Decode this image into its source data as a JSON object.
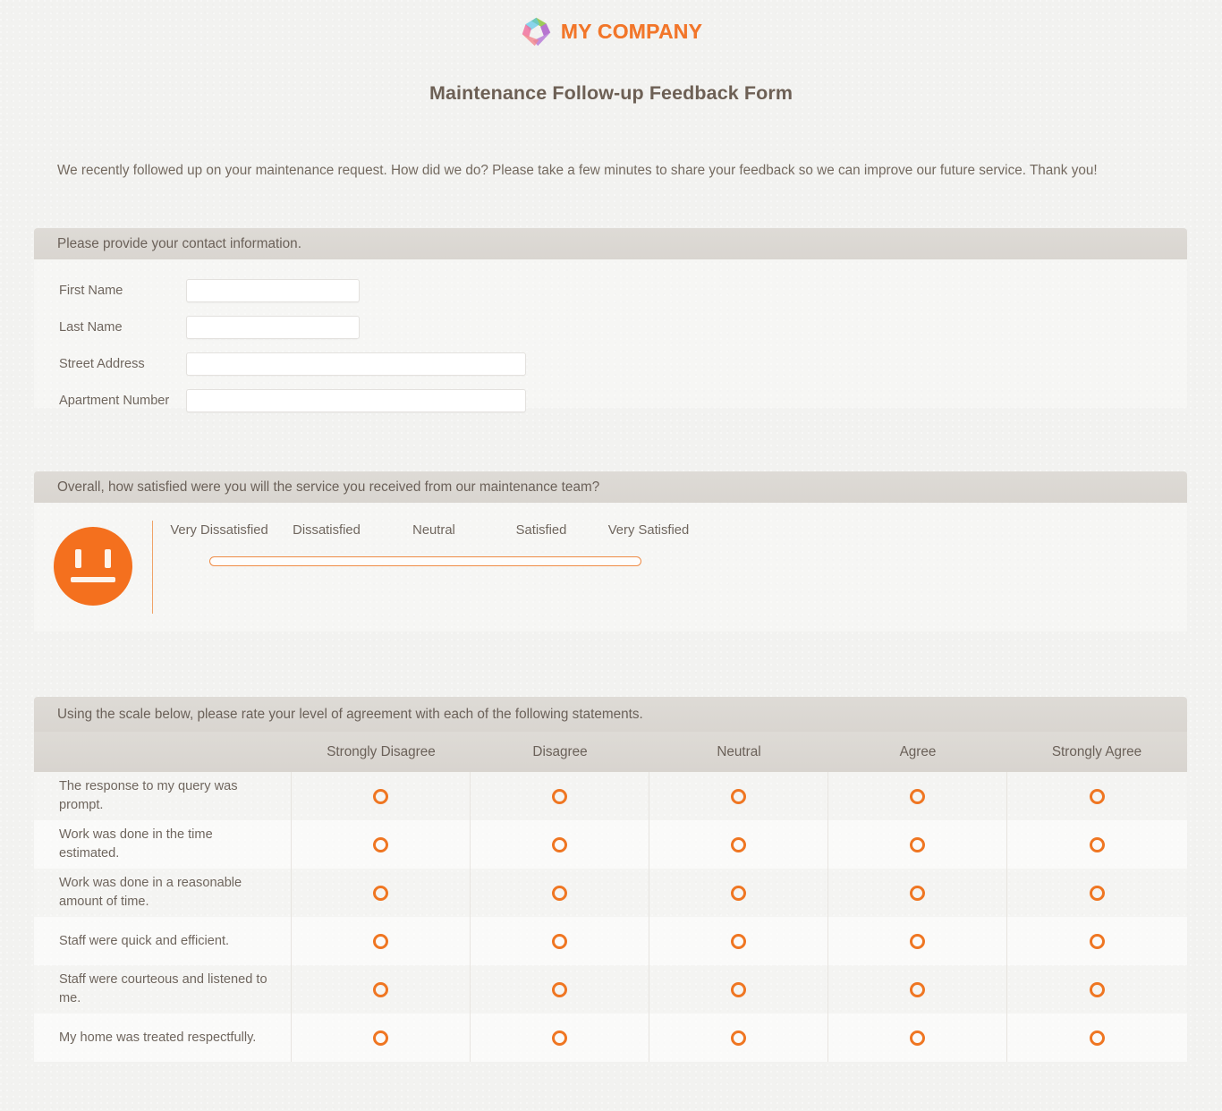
{
  "brand": {
    "logo_icon": "pinwheel-diamond-logo-icon",
    "name": "MY COMPANY",
    "logo_colors": [
      "#f06a9a",
      "#8dc63f",
      "#a855c8",
      "#4fa8e0"
    ],
    "text_color": "#f2762a"
  },
  "page": {
    "title": "Maintenance Follow-up Feedback Form",
    "intro": "We recently followed up on your maintenance request. How did we do? Please take a few minutes to share your feedback so we can improve our future service. Thank you!",
    "background_color": "#f2f2f0",
    "accent_color": "#ef7622",
    "header_bar_color": "#dedbd6",
    "text_color": "#6f665e"
  },
  "contact_section": {
    "heading": "Please provide your contact information.",
    "fields": [
      {
        "label": "First Name",
        "value": "",
        "placeholder": "",
        "size": "short"
      },
      {
        "label": "Last Name",
        "value": "",
        "placeholder": "",
        "size": "short"
      },
      {
        "label": "Street Address",
        "value": "",
        "placeholder": "",
        "size": "long"
      },
      {
        "label": "Apartment Number",
        "value": "",
        "placeholder": "",
        "size": "long"
      }
    ]
  },
  "satisfaction_section": {
    "heading": "Overall, how satisfied were you will the service you received from our maintenance team?",
    "face_icon": "neutral-face-icon",
    "scale_labels": [
      "Very Dissatisfied",
      "Dissatisfied",
      "Neutral",
      "Satisfied",
      "Very Satisfied"
    ],
    "slider_value": ""
  },
  "matrix_section": {
    "heading": "Using the scale below, please rate your level of agreement with each of the following statements.",
    "columns": [
      "Strongly Disagree",
      "Disagree",
      "Neutral",
      "Agree",
      "Strongly Agree"
    ],
    "rows": [
      {
        "statement": "The response to my query was prompt.",
        "selected": null
      },
      {
        "statement": "Work was done in the time estimated.",
        "selected": null
      },
      {
        "statement": "Work was done in a reasonable amount of time.",
        "selected": null
      },
      {
        "statement": "Staff were quick and efficient.",
        "selected": null
      },
      {
        "statement": "Staff were courteous and listened to me.",
        "selected": null
      },
      {
        "statement": "My home was treated respectfully.",
        "selected": null
      }
    ]
  }
}
